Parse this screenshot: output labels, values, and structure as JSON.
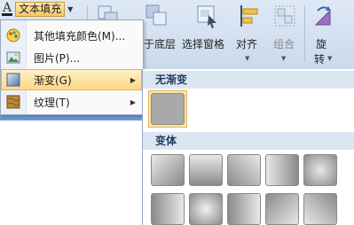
{
  "ribbon": {
    "text_fill_label": "文本填充",
    "send_to_back_partial": "于底层",
    "selection_pane_label": "选择窗格",
    "align_label": "对齐",
    "group_label": "组合",
    "rotate_label_line1": "旋",
    "rotate_label_line2": "转"
  },
  "menu": {
    "items": [
      {
        "label": "其他填充颜色(M)...",
        "icon": "color-palette-icon",
        "submenu": false
      },
      {
        "label": "图片(P)...",
        "icon": "picture-icon",
        "submenu": false
      },
      {
        "label": "渐变(G)",
        "icon": "gradient-icon",
        "submenu": true,
        "active": true
      },
      {
        "label": "纹理(T)",
        "icon": "texture-icon",
        "submenu": true
      }
    ]
  },
  "gallery": {
    "no_gradient_header": "无渐变",
    "variants_header": "变体",
    "swatch_color": "#a9a9a9"
  }
}
